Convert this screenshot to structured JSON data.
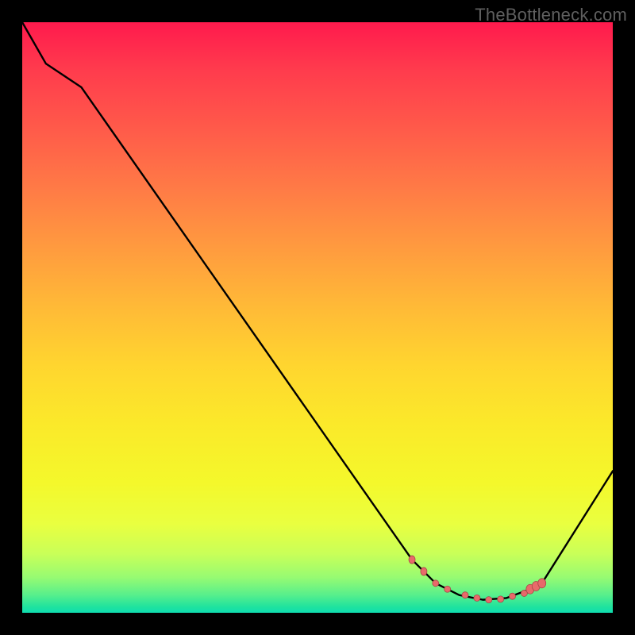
{
  "watermark": "TheBottleneck.com",
  "colors": {
    "gradient_top": "#ff1a4d",
    "gradient_mid": "#ffd52f",
    "gradient_bottom": "#0fddb0",
    "curve": "#000000",
    "dot_fill": "#e86a6a",
    "dot_stroke": "#a84848",
    "frame": "#000000",
    "watermark": "#5f5f5f"
  },
  "chart_data": {
    "type": "line",
    "title": "",
    "xlabel": "",
    "ylabel": "",
    "xlim": [
      0,
      100
    ],
    "ylim": [
      0,
      100
    ],
    "grid": false,
    "legend": false,
    "series": [
      {
        "name": "bottleneck-curve",
        "x": [
          0,
          4,
          10,
          66,
          70,
          74,
          78,
          82,
          86,
          88,
          100
        ],
        "y": [
          100,
          93,
          89,
          9,
          5,
          3,
          2.2,
          2.5,
          4,
          5,
          24
        ]
      }
    ],
    "markers": {
      "name": "highlight-dots",
      "x": [
        66,
        68,
        70,
        72,
        75,
        77,
        79,
        81,
        83,
        85,
        86,
        87,
        88
      ],
      "y": [
        9,
        7,
        5,
        4,
        3,
        2.5,
        2.2,
        2.3,
        2.8,
        3.3,
        4,
        4.5,
        5
      ],
      "rx": [
        4,
        4,
        4,
        4,
        4,
        4,
        4,
        4,
        4,
        4,
        5,
        5,
        5
      ],
      "ry": [
        5,
        5,
        4,
        4,
        4,
        4,
        4,
        4,
        4,
        4,
        6,
        6,
        6
      ]
    }
  }
}
